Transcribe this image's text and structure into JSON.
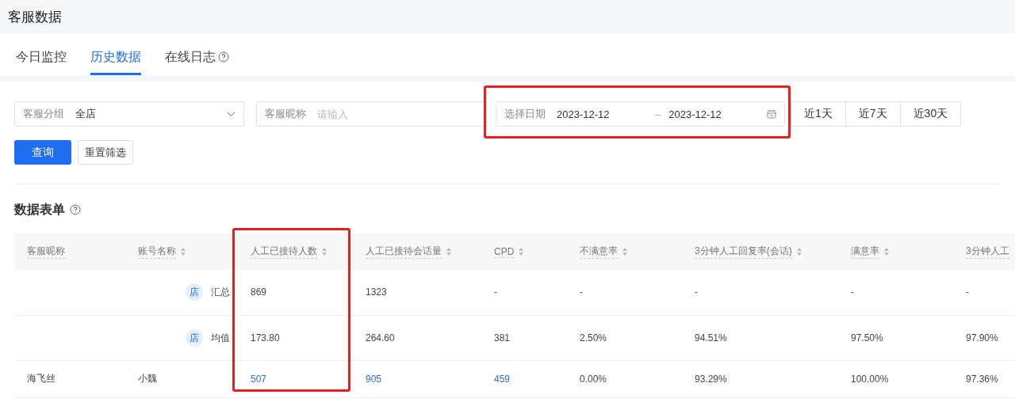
{
  "page_title": "客服数据",
  "tabs": [
    {
      "label": "今日监控",
      "selected": false,
      "help": false
    },
    {
      "label": "历史数据",
      "selected": true,
      "help": false
    },
    {
      "label": "在线日志",
      "selected": false,
      "help": true
    }
  ],
  "filters": {
    "group": {
      "label": "客服分组",
      "value": "全店"
    },
    "nickname": {
      "label": "客服昵称",
      "placeholder": "请输入"
    },
    "date": {
      "label": "选择日期",
      "start": "2023-12-12",
      "separator": "–",
      "end": "2023-12-12"
    },
    "quick_ranges": [
      "近1天",
      "近7天",
      "近30天"
    ]
  },
  "buttons": {
    "query": "查询",
    "reset": "重置筛选"
  },
  "section_title": "数据表单",
  "table": {
    "columns": [
      {
        "label": "客服昵称",
        "sortable": false
      },
      {
        "label": "账号名称",
        "sortable": true
      },
      {
        "label": "人工已接待人数",
        "sortable": true
      },
      {
        "label": "人工已接待会话量",
        "sortable": true
      },
      {
        "label": "CPD",
        "sortable": true
      },
      {
        "label": "不满意率",
        "sortable": true
      },
      {
        "label": "3分钟人工回复率(会话)",
        "sortable": true
      },
      {
        "label": "满意率",
        "sortable": true
      },
      {
        "label": "3分钟人工"
      }
    ],
    "rows": [
      {
        "cells": [
          {
            "text": ""
          },
          {
            "text": "汇总",
            "badge": "店",
            "link": false
          },
          {
            "text": "869",
            "link": false
          },
          {
            "text": "1323",
            "link": false
          },
          {
            "text": "-",
            "link": false
          },
          {
            "text": "-",
            "link": false
          },
          {
            "text": "-",
            "link": false
          },
          {
            "text": "-",
            "link": false
          },
          {
            "text": "-",
            "link": false
          }
        ]
      },
      {
        "cells": [
          {
            "text": ""
          },
          {
            "text": "均值",
            "badge": "店",
            "link": false
          },
          {
            "text": "173.80",
            "link": false
          },
          {
            "text": "264.60",
            "link": false
          },
          {
            "text": "381",
            "link": false
          },
          {
            "text": "2.50%",
            "link": false
          },
          {
            "text": "94.51%",
            "link": false
          },
          {
            "text": "97.50%",
            "link": false
          },
          {
            "text": "97.90%",
            "link": false
          }
        ]
      },
      {
        "cells": [
          {
            "text": "海飞丝",
            "link": false
          },
          {
            "text": "小魏",
            "link": false
          },
          {
            "text": "507",
            "link": true
          },
          {
            "text": "905",
            "link": true
          },
          {
            "text": "459",
            "link": true
          },
          {
            "text": "0.00%",
            "link": false
          },
          {
            "text": "93.29%",
            "link": false
          },
          {
            "text": "100.00%",
            "link": false
          },
          {
            "text": "97.36%",
            "link": false
          }
        ]
      }
    ]
  }
}
